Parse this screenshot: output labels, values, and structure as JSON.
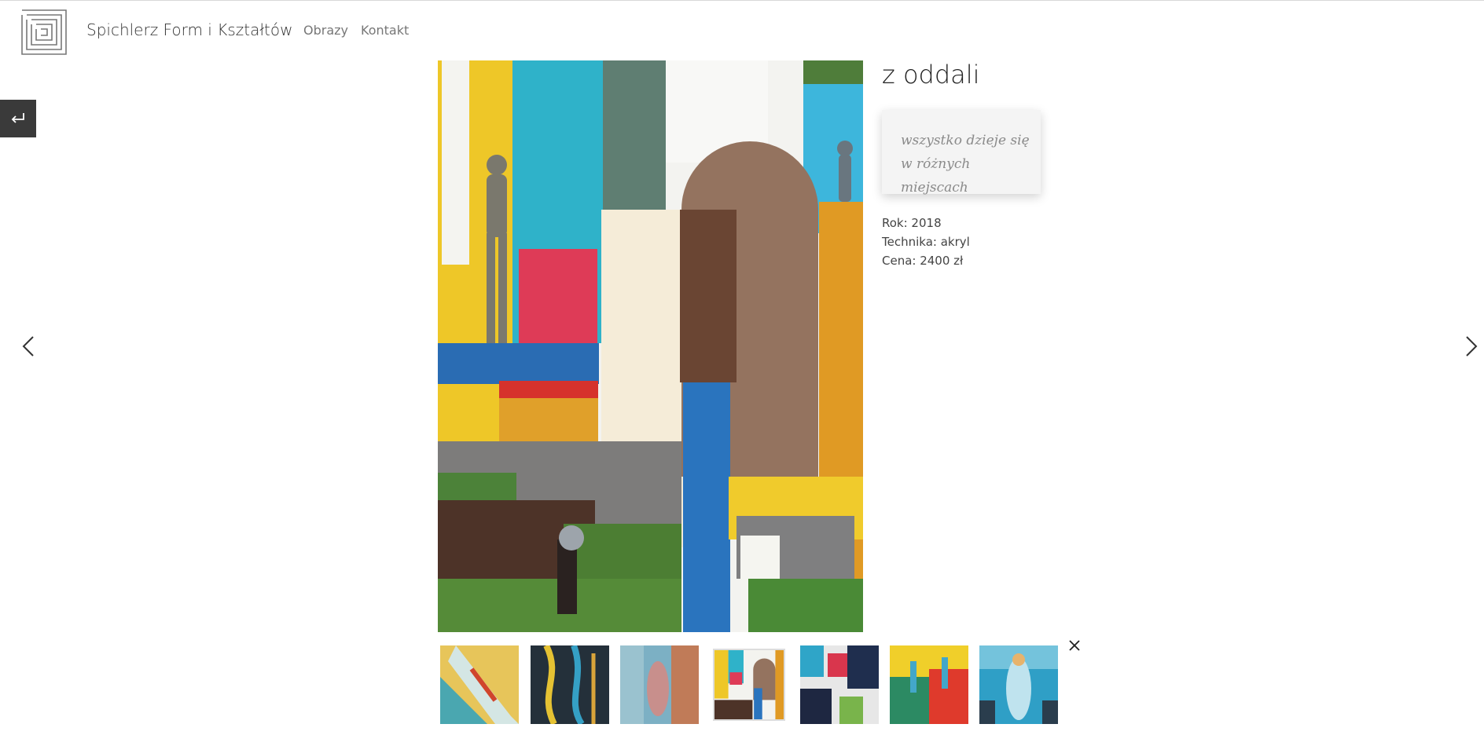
{
  "site": {
    "title": "Spichlerz Form i Kształtów"
  },
  "nav": {
    "items": [
      "Obrazy",
      "Kontakt"
    ]
  },
  "controls": {
    "back": "back-icon",
    "prev": "chevron-left-icon",
    "next": "chevron-right-icon",
    "close": "close-icon"
  },
  "artwork": {
    "title": "z oddali",
    "quote_line1": "wszystko dzieje się",
    "quote_line2": "w różnych miejscach",
    "year": "Rok: 2018",
    "technique": "Technika: akryl",
    "price": "Cena: 2400 zł"
  },
  "thumbnails": {
    "count": 7,
    "active_index": 3
  }
}
